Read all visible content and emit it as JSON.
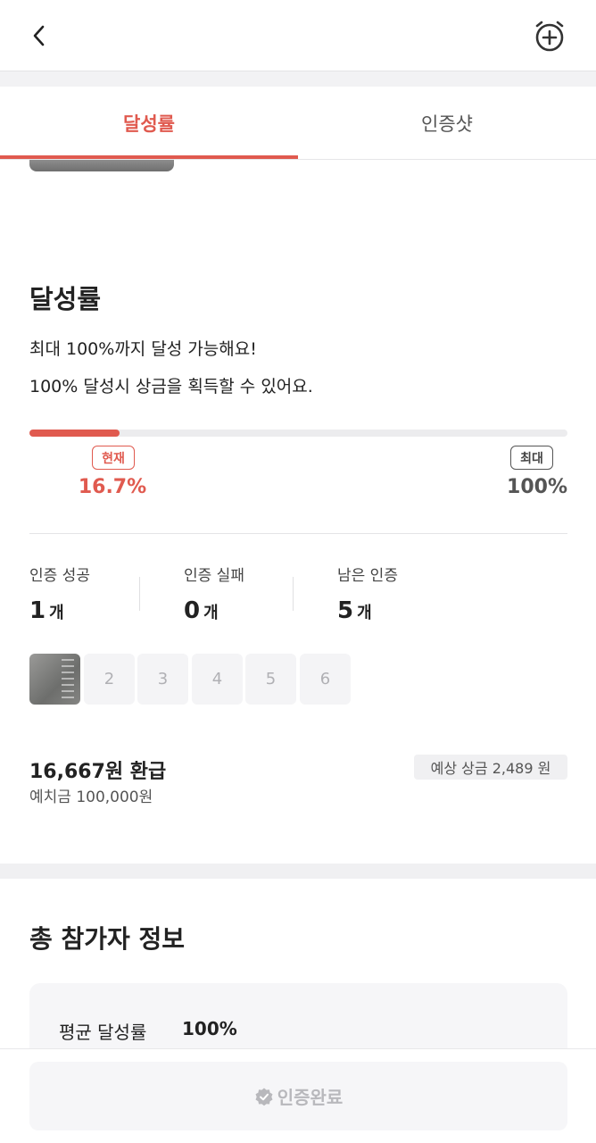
{
  "tabs": [
    {
      "label": "달성률"
    },
    {
      "label": "인증샷"
    }
  ],
  "achievement": {
    "title": "달성률",
    "desc1": "최대 100%까지 달성 가능해요!",
    "desc2": "100% 달성시 상금을 획득할 수 있어요.",
    "progress_fraction": 0.167,
    "current_badge": "현재",
    "current_value": "16.7%",
    "max_badge": "최대",
    "max_value": "100%"
  },
  "stats": [
    {
      "label": "인증 성공",
      "count": "1",
      "unit": "개"
    },
    {
      "label": "인증 실패",
      "count": "0",
      "unit": "개"
    },
    {
      "label": "남은 인증",
      "count": "5",
      "unit": "개"
    }
  ],
  "thumbs": [
    "2",
    "3",
    "4",
    "5",
    "6"
  ],
  "money": {
    "refund": "16,667원 환급",
    "deposit": "예치금 100,000원",
    "prize": "예상 상금 2,489 원"
  },
  "participants": {
    "title": "총 참가자 정보",
    "avg_label": "평균 달성률",
    "avg_value": "100%"
  },
  "cta": {
    "label": "인증완료"
  },
  "colors": {
    "accent": "#e05a4f",
    "muted": "#b8b8bc"
  }
}
